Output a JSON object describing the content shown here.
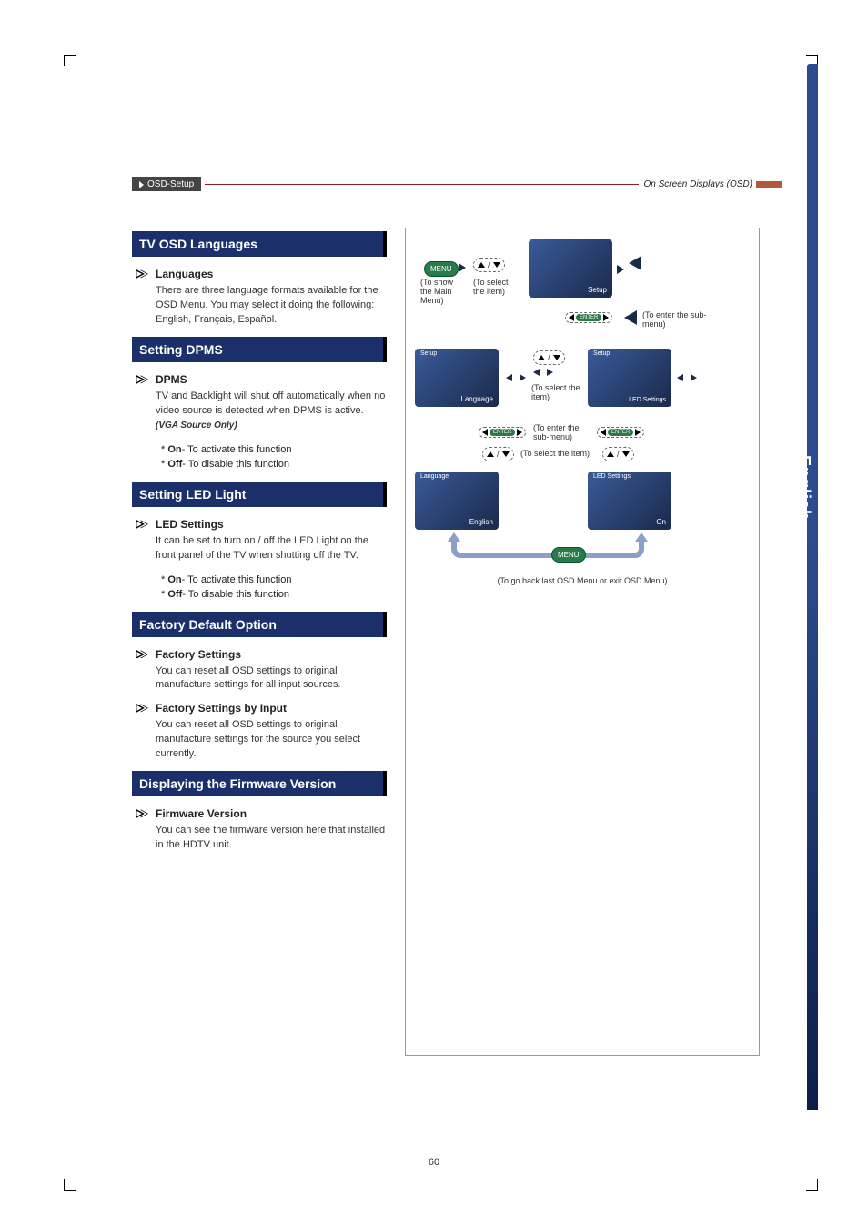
{
  "header": {
    "breadcrumb": "OSD-Setup",
    "right": "On Screen Displays (OSD)"
  },
  "side_tab": "English",
  "page_number": "60",
  "sections": [
    {
      "title": "TV OSD Languages",
      "subs": [
        {
          "heading": "Languages",
          "body": "There are three language formats available for the OSD Menu. You may select it doing the following: English, Français, Español."
        }
      ]
    },
    {
      "title": "Setting DPMS",
      "subs": [
        {
          "heading": "DPMS",
          "body": "TV and Backlight will shut off automatically when no video source is detected when DPMS is active.",
          "note": "(VGA Source Only)",
          "opts": [
            {
              "lead": "* ",
              "key": "On",
              "rest": "- To activate this function"
            },
            {
              "lead": "* ",
              "key": "Off",
              "rest": "- To disable this function"
            }
          ]
        }
      ]
    },
    {
      "title": "Setting LED Light",
      "subs": [
        {
          "heading": "LED Settings",
          "body": "It can be set to turn on / off the LED Light on the front panel of the TV when shutting off the TV.",
          "opts": [
            {
              "lead": "* ",
              "key": "On",
              "rest": "- To activate this function"
            },
            {
              "lead": "* ",
              "key": "Off",
              "rest": "- To disable this function"
            }
          ]
        }
      ]
    },
    {
      "title": "Factory Default Option",
      "subs": [
        {
          "heading": "Factory Settings",
          "body": "You can reset all OSD settings to original manufacture settings for all input sources."
        },
        {
          "heading": "Factory Settings by Input",
          "body": "You can reset all OSD settings to original manufacture settings for the source you select currently."
        }
      ]
    },
    {
      "title": "Displaying the Firmware Version",
      "subs": [
        {
          "heading": "Firmware Version",
          "body": "You can see the firmware version here that installed in the HDTV unit."
        }
      ]
    }
  ],
  "flow": {
    "menu_btn": "MENU",
    "enter_btn": "ENTER",
    "cap_show_main": "(To show the Main Menu)",
    "cap_select_item": "(To select the item)",
    "cap_enter_sub": "(To enter the sub-menu)",
    "cap_select_item2": "(To select the item)",
    "cap_enter_sub2": "(To enter the sub-menu)",
    "cap_select_item3": "(To select the item)",
    "cap_back_exit": "(To go back last OSD Menu or exit OSD Menu)",
    "thumb_setup": "Setup",
    "thumb_language": "Language",
    "thumb_led": "LED Settings",
    "thumb_english": "English",
    "thumb_on": "On"
  }
}
